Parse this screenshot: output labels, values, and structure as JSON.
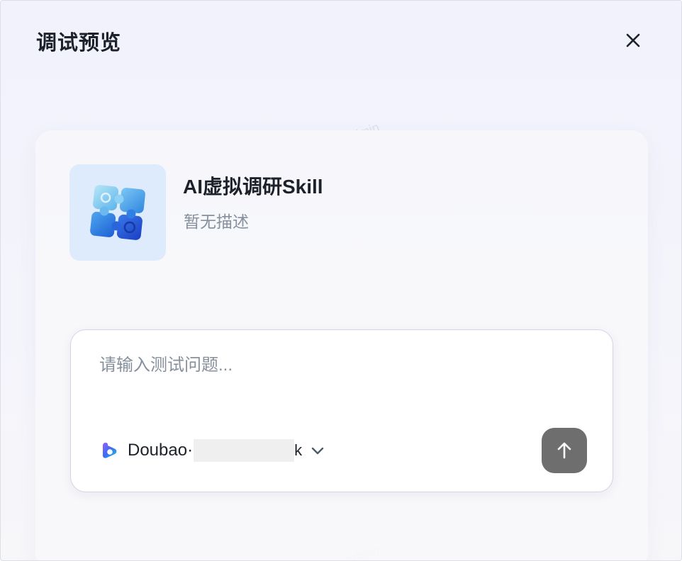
{
  "dialog": {
    "title": "调试预览",
    "close_icon": "close-icon"
  },
  "skill": {
    "icon": "puzzle-icon",
    "name": "AI虚拟调研Skill",
    "description": "暂无描述"
  },
  "composer": {
    "placeholder": "请输入测试问题...",
    "model": {
      "logo": "doubao-logo-icon",
      "name": "Doubao·",
      "suffix": "k",
      "dropdown_icon": "chevron-down-icon"
    },
    "send_icon": "arrow-up-icon"
  },
  "watermark": {
    "text": "admin"
  },
  "colors": {
    "send_button": "#6e6e6e",
    "icon_tile": "#deebfd",
    "description_text": "#86909c"
  }
}
